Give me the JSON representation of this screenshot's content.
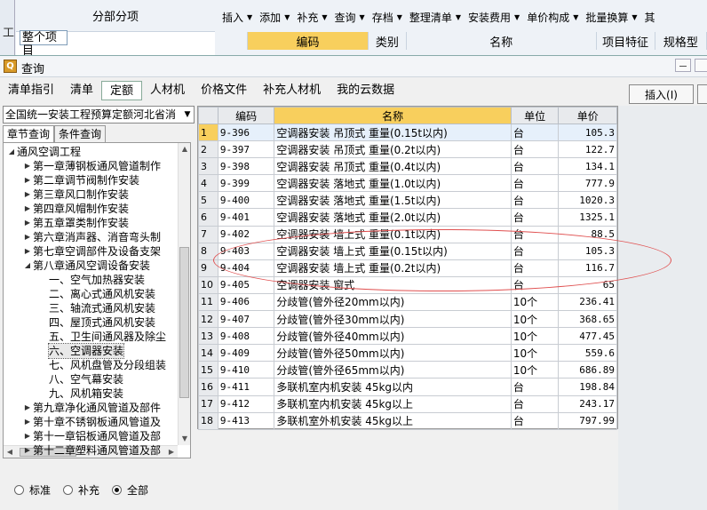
{
  "background_app": {
    "left_glyph": "工",
    "section_title": "分部分项",
    "section_item": "整个项目",
    "toolbar": [
      {
        "label": "插入",
        "dropdown": true
      },
      {
        "label": "添加",
        "dropdown": true
      },
      {
        "label": "补充",
        "dropdown": true
      },
      {
        "label": "查询",
        "dropdown": true
      },
      {
        "label": "存档",
        "dropdown": true
      },
      {
        "label": "整理清单",
        "dropdown": true
      },
      {
        "label": "安装费用",
        "dropdown": true
      },
      {
        "label": "单价构成",
        "dropdown": true
      },
      {
        "label": "批量换算",
        "dropdown": true
      },
      {
        "label": "其",
        "dropdown": false
      }
    ],
    "grid_headers": [
      "编码",
      "类别",
      "名称",
      "项目特征",
      "规格型"
    ]
  },
  "window": {
    "title": "查询",
    "icon": "query-window-icon",
    "tabs": [
      "清单指引",
      "清单",
      "定额",
      "人材机",
      "价格文件",
      "补充人材机",
      "我的云数据"
    ],
    "active_tab": "定额",
    "insert_button": "插入(I)"
  },
  "left_panel": {
    "quota_library": "全国统一安装工程预算定额河北省消",
    "subtabs": [
      "章节查询",
      "条件查询"
    ],
    "active_subtab": "章节查询",
    "tree": [
      {
        "label": "通风空调工程",
        "level": 0,
        "expander": "minus"
      },
      {
        "label": "第一章薄钢板通风管道制作",
        "level": 1,
        "expander": "plus"
      },
      {
        "label": "第二章调节阀制作安装",
        "level": 1,
        "expander": "plus"
      },
      {
        "label": "第三章风口制作安装",
        "level": 1,
        "expander": "plus"
      },
      {
        "label": "第四章风帽制作安装",
        "level": 1,
        "expander": "plus"
      },
      {
        "label": "第五章罩类制作安装",
        "level": 1,
        "expander": "plus"
      },
      {
        "label": "第六章消声器、消音弯头制",
        "level": 1,
        "expander": "plus"
      },
      {
        "label": "第七章空调部件及设备支架",
        "level": 1,
        "expander": "plus"
      },
      {
        "label": "第八章通风空调设备安装",
        "level": 1,
        "expander": "minus"
      },
      {
        "label": "一、空气加热器安装",
        "level": 2,
        "expander": "none"
      },
      {
        "label": "二、离心式通风机安装",
        "level": 2,
        "expander": "none"
      },
      {
        "label": "三、轴流式通风机安装",
        "level": 2,
        "expander": "none"
      },
      {
        "label": "四、屋顶式通风机安装",
        "level": 2,
        "expander": "none"
      },
      {
        "label": "五、卫生间通风器及除尘",
        "level": 2,
        "expander": "none"
      },
      {
        "label": "六、空调器安装",
        "level": 2,
        "expander": "none",
        "selected": true
      },
      {
        "label": "七、风机盘管及分段组装",
        "level": 2,
        "expander": "none"
      },
      {
        "label": "八、空气幕安装",
        "level": 2,
        "expander": "none"
      },
      {
        "label": "九、风机箱安装",
        "level": 2,
        "expander": "none"
      },
      {
        "label": "第九章净化通风管道及部件",
        "level": 1,
        "expander": "plus"
      },
      {
        "label": "第十章不锈钢板通风管道及",
        "level": 1,
        "expander": "plus"
      },
      {
        "label": "第十一章铝板通风管道及部",
        "level": 1,
        "expander": "plus"
      },
      {
        "label": "第十二章塑料通风管道及部",
        "level": 1,
        "expander": "plus"
      }
    ],
    "filter_options": [
      "标准",
      "补充",
      "全部"
    ],
    "filter_selected": "全部"
  },
  "grid": {
    "columns": [
      "编码",
      "名称",
      "单位",
      "单价"
    ],
    "rows": [
      {
        "no": "1",
        "code": "9-396",
        "name": "空调器安装 吊顶式 重量(0.15t以内)",
        "unit": "台",
        "price": "105.3"
      },
      {
        "no": "2",
        "code": "9-397",
        "name": "空调器安装 吊顶式 重量(0.2t以内)",
        "unit": "台",
        "price": "122.7"
      },
      {
        "no": "3",
        "code": "9-398",
        "name": "空调器安装 吊顶式 重量(0.4t以内)",
        "unit": "台",
        "price": "134.1"
      },
      {
        "no": "4",
        "code": "9-399",
        "name": "空调器安装 落地式 重量(1.0t以内)",
        "unit": "台",
        "price": "777.9"
      },
      {
        "no": "5",
        "code": "9-400",
        "name": "空调器安装 落地式 重量(1.5t以内)",
        "unit": "台",
        "price": "1020.3"
      },
      {
        "no": "6",
        "code": "9-401",
        "name": "空调器安装 落地式 重量(2.0t以内)",
        "unit": "台",
        "price": "1325.1"
      },
      {
        "no": "7",
        "code": "9-402",
        "name": "空调器安装 墙上式 重量(0.1t以内)",
        "unit": "台",
        "price": "88.5"
      },
      {
        "no": "8",
        "code": "9-403",
        "name": "空调器安装 墙上式 重量(0.15t以内)",
        "unit": "台",
        "price": "105.3"
      },
      {
        "no": "9",
        "code": "9-404",
        "name": "空调器安装 墙上式 重量(0.2t以内)",
        "unit": "台",
        "price": "116.7"
      },
      {
        "no": "10",
        "code": "9-405",
        "name": "空调器安装 窗式",
        "unit": "台",
        "price": "65"
      },
      {
        "no": "11",
        "code": "9-406",
        "name": "分歧管(管外径20mm以内)",
        "unit": "10个",
        "price": "236.41"
      },
      {
        "no": "12",
        "code": "9-407",
        "name": "分歧管(管外径30mm以内)",
        "unit": "10个",
        "price": "368.65"
      },
      {
        "no": "13",
        "code": "9-408",
        "name": "分歧管(管外径40mm以内)",
        "unit": "10个",
        "price": "477.45"
      },
      {
        "no": "14",
        "code": "9-409",
        "name": "分歧管(管外径50mm以内)",
        "unit": "10个",
        "price": "559.6"
      },
      {
        "no": "15",
        "code": "9-410",
        "name": "分歧管(管外径65mm以内)",
        "unit": "10个",
        "price": "686.89"
      },
      {
        "no": "16",
        "code": "9-411",
        "name": "多联机室内机安装 45kg以内",
        "unit": "台",
        "price": "198.84"
      },
      {
        "no": "17",
        "code": "9-412",
        "name": "多联机室内机安装 45kg以上",
        "unit": "台",
        "price": "243.17"
      },
      {
        "no": "18",
        "code": "9-413",
        "name": "多联机室外机安装 45kg以上",
        "unit": "台",
        "price": "797.99"
      }
    ]
  },
  "colors": {
    "header_highlight": "#f8cf5d",
    "annotation": "#e05050",
    "selected_row": "#e6f0fb"
  }
}
